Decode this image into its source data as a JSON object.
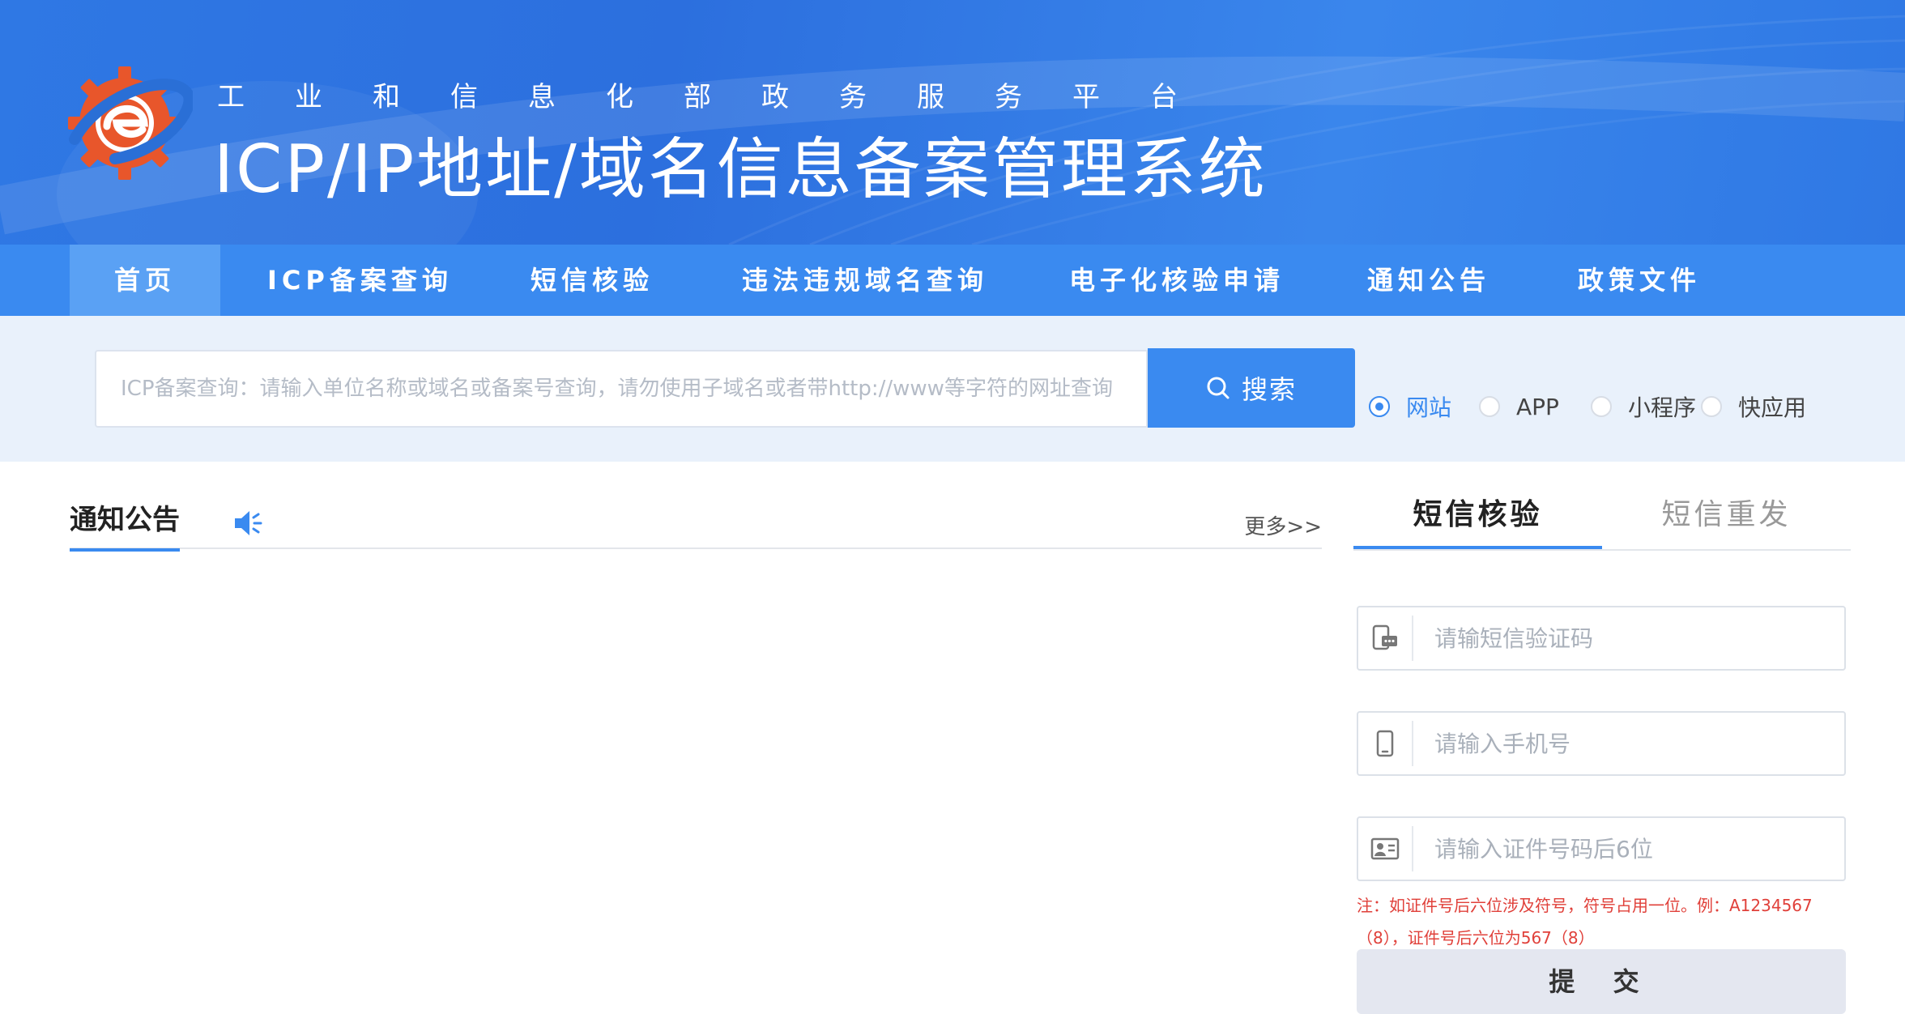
{
  "header": {
    "subtitle": "工业和信息化部政务服务平台",
    "title": "ICP/IP地址/域名信息备案管理系统"
  },
  "nav": {
    "items": [
      {
        "label": "首页",
        "active": true
      },
      {
        "label": "ICP备案查询"
      },
      {
        "label": "短信核验"
      },
      {
        "label": "违法违规域名查询"
      },
      {
        "label": "电子化核验申请"
      },
      {
        "label": "通知公告"
      },
      {
        "label": "政策文件"
      }
    ]
  },
  "search": {
    "placeholder": "ICP备案查询：请输入单位名称或域名或备案号查询，请勿使用子域名或者带http://www等字符的网址查询",
    "button_label": "搜索",
    "types": [
      {
        "label": "网站",
        "checked": true
      },
      {
        "label": "APP"
      },
      {
        "label": "小程序"
      },
      {
        "label": "快应用"
      }
    ]
  },
  "notice": {
    "title": "通知公告",
    "more_label": "更多>>"
  },
  "sms": {
    "tabs": [
      "短信核验",
      "短信重发"
    ],
    "code_placeholder": "请输短信验证码",
    "phone_placeholder": "请输入手机号",
    "id_placeholder": "请输入证件号码后6位",
    "note": "注：如证件号后六位涉及符号，符号占用一位。例：A1234567（8），证件号后六位为567（8）",
    "submit_label": "提 交"
  },
  "colors": {
    "primary": "#3a8af0",
    "banner": "#2f78e4",
    "note_red": "#e0403a"
  }
}
